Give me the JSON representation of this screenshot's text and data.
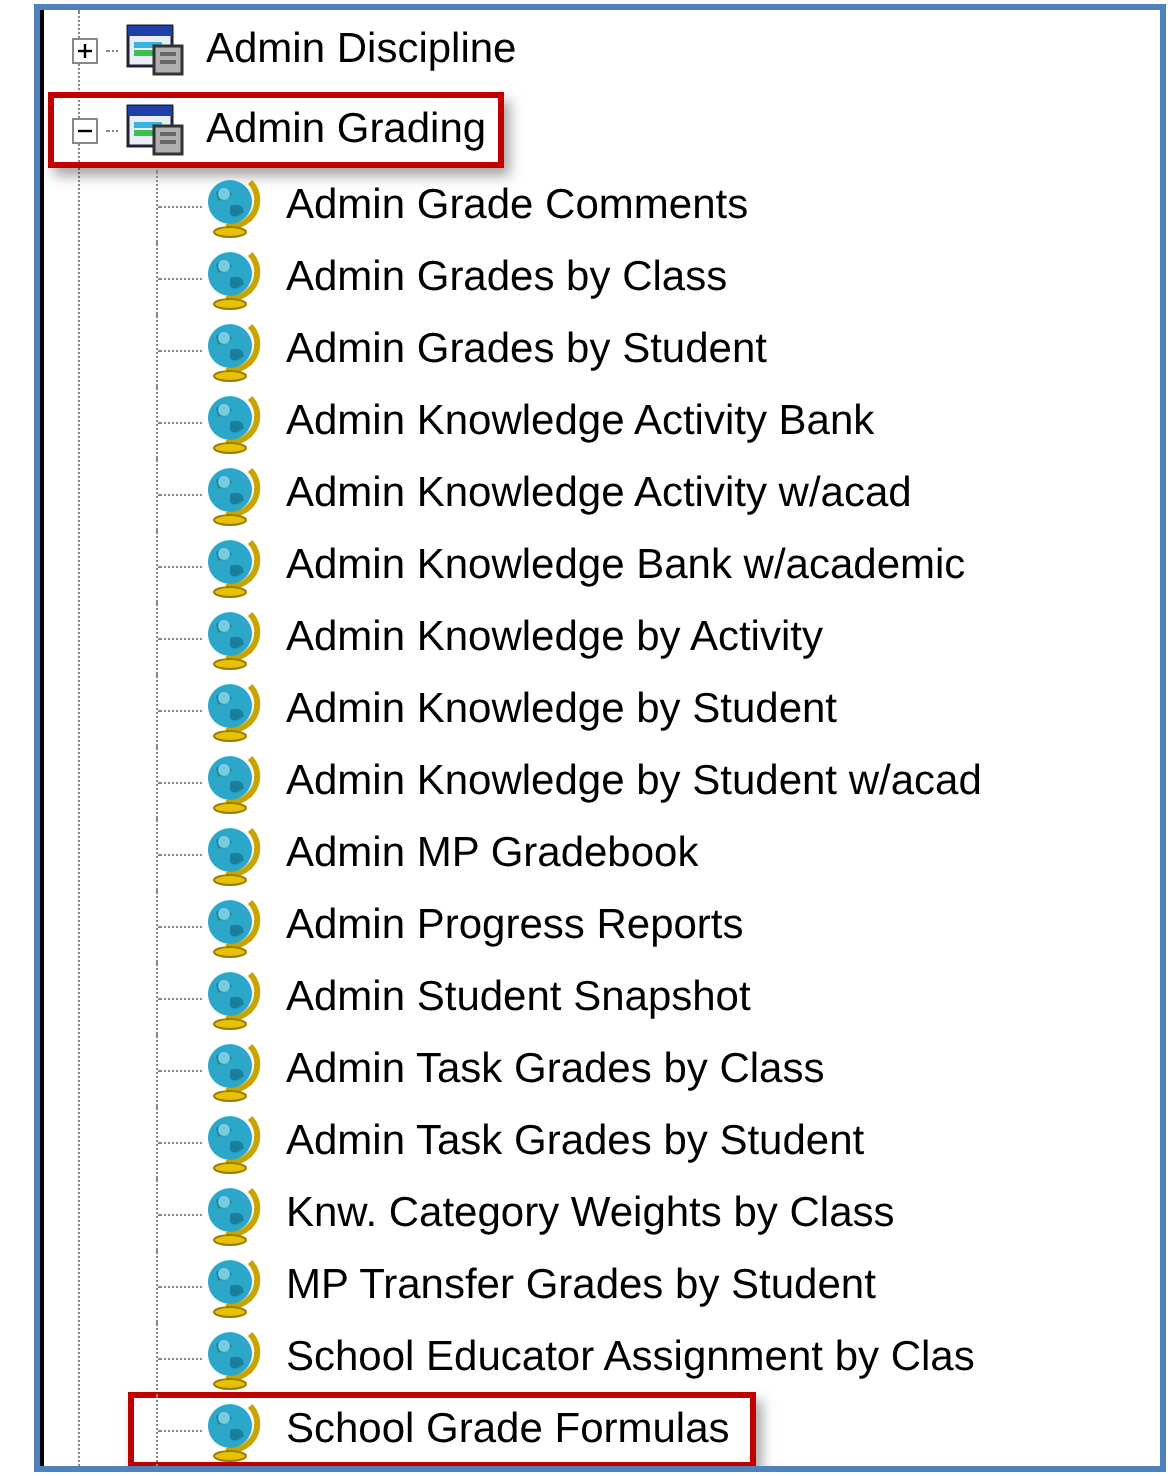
{
  "tree": [
    {
      "label": "Admin Discipline",
      "expanded": false,
      "highlighted": false
    },
    {
      "label": "Admin Grading",
      "expanded": true,
      "highlighted": true,
      "children": [
        {
          "label": "Admin Grade Comments",
          "highlighted": false
        },
        {
          "label": "Admin Grades by Class",
          "highlighted": false
        },
        {
          "label": "Admin Grades by Student",
          "highlighted": false
        },
        {
          "label": "Admin Knowledge Activity Bank",
          "highlighted": false
        },
        {
          "label": "Admin Knowledge Activity w/acad",
          "highlighted": false
        },
        {
          "label": "Admin Knowledge Bank w/academic",
          "highlighted": false
        },
        {
          "label": "Admin Knowledge by Activity",
          "highlighted": false
        },
        {
          "label": "Admin Knowledge by Student",
          "highlighted": false
        },
        {
          "label": "Admin Knowledge by Student w/acad",
          "highlighted": false
        },
        {
          "label": "Admin MP Gradebook",
          "highlighted": false
        },
        {
          "label": "Admin Progress Reports",
          "highlighted": false
        },
        {
          "label": "Admin Student Snapshot",
          "highlighted": false
        },
        {
          "label": "Admin Task Grades by Class",
          "highlighted": false
        },
        {
          "label": "Admin Task Grades by Student",
          "highlighted": false
        },
        {
          "label": "Knw. Category Weights by Class",
          "highlighted": false
        },
        {
          "label": "MP Transfer Grades by Student",
          "highlighted": false
        },
        {
          "label": "School Educator Assignment by Clas",
          "highlighted": false
        },
        {
          "label": "School Grade Formulas",
          "highlighted": true
        }
      ]
    }
  ]
}
